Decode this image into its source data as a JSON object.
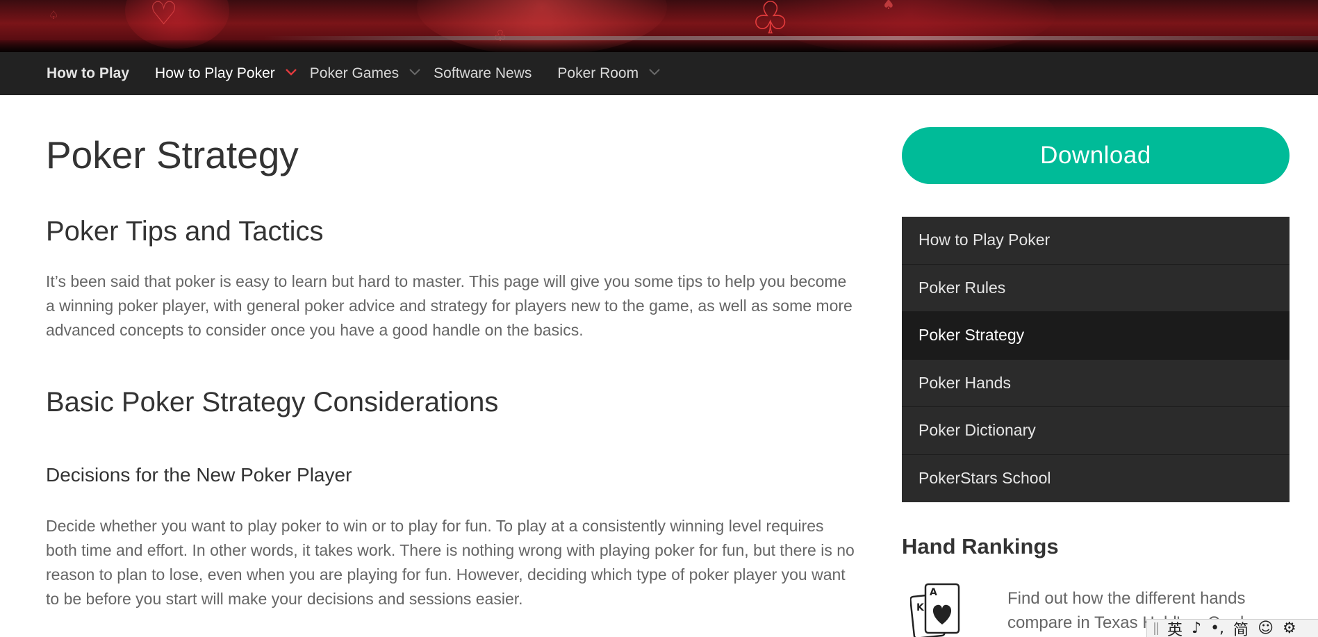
{
  "nav": {
    "brand": "How to Play",
    "items": [
      {
        "label": "How to Play Poker"
      },
      {
        "label": "Poker Games"
      },
      {
        "label": "Software News"
      },
      {
        "label": "Poker Room"
      }
    ]
  },
  "main": {
    "title": "Poker Strategy",
    "section1_heading": "Poker Tips and Tactics",
    "section1_paragraph": "It’s been said that poker is easy to learn but hard to master. This page will give you some tips to help you become a winning poker player, with general poker advice and strategy for players new to the game, as well as some more advanced concepts to consider once you have a good handle on the basics.",
    "section2_heading": "Basic Poker Strategy Considerations",
    "subsection_heading": "Decisions for the New Poker Player",
    "subsection_paragraph": "Decide whether you want to play poker to win or to play for fun. To play at a consistently winning level requires both time and effort. In other words, it takes work. There is nothing wrong with playing poker for fun, but there is no reason to plan to lose, even when you are playing for fun. However, deciding which type of poker player you want to be before you start will make your decisions and sessions easier."
  },
  "sidebar": {
    "download_label": "Download",
    "menu": [
      {
        "label": "How to Play Poker"
      },
      {
        "label": "Poker Rules"
      },
      {
        "label": "Poker Strategy"
      },
      {
        "label": "Poker Hands"
      },
      {
        "label": "Poker Dictionary"
      },
      {
        "label": "PokerStars School"
      }
    ],
    "hand_rankings_heading": "Hand Rankings",
    "hand_rankings_text": "Find out how the different hands compare in Texas Hold'em Card",
    "card_ranks": {
      "back": "K",
      "front": "A"
    }
  },
  "ime_toolbar": {
    "items": [
      "英",
      "♪",
      "•,",
      "简",
      "☺",
      "⚙"
    ]
  },
  "colors": {
    "navbar_bg": "#222222",
    "accent_chevron": "#e03a3e",
    "download_bg": "#00bb98",
    "sidebar_menu_bg": "#2b2b2b",
    "sidebar_active_bg": "#1b1b1b"
  }
}
